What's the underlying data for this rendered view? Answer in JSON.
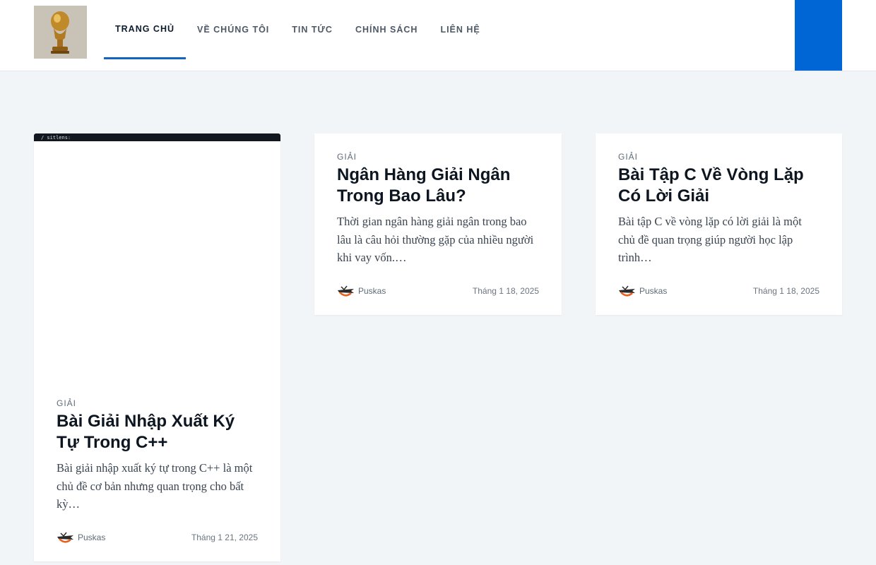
{
  "header": {
    "logo_icon": "trophy-icon",
    "nav": [
      {
        "label": "TRANG CHỦ",
        "active": true
      },
      {
        "label": "VỀ CHÚNG TÔI",
        "active": false
      },
      {
        "label": "TIN TỨC",
        "active": false
      },
      {
        "label": "CHÍNH SÁCH",
        "active": false
      },
      {
        "label": "LIÊN HỆ",
        "active": false
      }
    ],
    "accent_color": "#0066d6"
  },
  "posts": [
    {
      "thumbnail_text": "/ sitlens:",
      "category": "GIẢI",
      "title": "Bài Giải Nhập Xuất Ký Tự Trong C++",
      "excerpt": "Bài giải nhập xuất ký tự trong C++ là một chủ đề cơ bản nhưng quan trọng cho bất kỳ…",
      "author": "Puskas",
      "date": "Tháng 1 21, 2025"
    },
    {
      "category": "GIẢI",
      "title": "Ngân Hàng Giải Ngân Trong Bao Lâu?",
      "excerpt": "Thời gian ngân hàng giải ngân trong bao lâu là câu hỏi thường gặp của nhiều người khi vay vốn.…",
      "author": "Puskas",
      "date": "Tháng 1 18, 2025"
    },
    {
      "category": "GIẢI",
      "title": "Bài Tập C Về Vòng Lặp Có Lời Giải",
      "excerpt": "Bài tập C về vòng lặp có lời giải là một chủ đề quan trọng giúp người học lập trình…",
      "author": "Puskas",
      "date": "Tháng 1 18, 2025"
    }
  ]
}
